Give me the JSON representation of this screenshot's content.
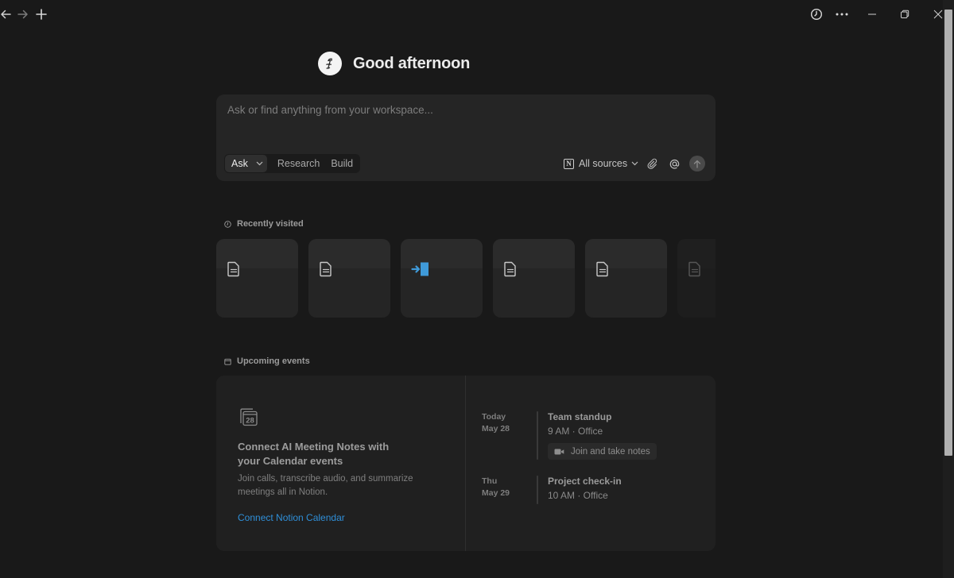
{
  "window": {
    "icons": [
      "back-arrow-icon",
      "forward-arrow-icon",
      "new-tab-plus-icon",
      "history-clock-icon",
      "more-ellipsis-icon",
      "minimize-icon",
      "restore-icon",
      "close-icon"
    ]
  },
  "greeting": {
    "text": "Good afternoon",
    "avatar_icon": "user-avatar-icon"
  },
  "ask_box": {
    "placeholder": "Ask or find anything from your workspace...",
    "modes": {
      "active": "Ask",
      "others": [
        "Research",
        "Build"
      ]
    },
    "sources_label": "All sources",
    "sources_icon": "notion-logo-icon",
    "tools": [
      "attachment-icon",
      "mention-at-icon",
      "send-arrow-icon"
    ]
  },
  "recently_visited": {
    "header": "Recently visited",
    "header_icon": "clock-icon",
    "cards": [
      {
        "icon": "page-icon"
      },
      {
        "icon": "page-icon"
      },
      {
        "icon": "sign-in-arrow-icon",
        "accent": "#3f9ad9"
      },
      {
        "icon": "page-icon"
      },
      {
        "icon": "page-icon"
      },
      {
        "icon": "page-icon",
        "faded": true
      }
    ]
  },
  "upcoming_events": {
    "header": "Upcoming events",
    "header_icon": "calendar-icon",
    "connect": {
      "icon": "calendar-28-icon",
      "calendar_day": "28",
      "title": "Connect AI Meeting Notes with your Calendar events",
      "description": "Join calls, transcribe audio, and summarize meetings all in Notion.",
      "link": "Connect Notion Calendar",
      "link_color": "#2f8fd8"
    },
    "events": [
      {
        "day": "Today",
        "date": "May 28",
        "title": "Team standup",
        "meta": "9 AM · Office",
        "join_label": "Join and take notes",
        "join_icon": "video-camera-icon"
      },
      {
        "day": "Thu",
        "date": "May 29",
        "title": "Project check-in",
        "meta": "10 AM · Office"
      }
    ]
  },
  "colors": {
    "background": "#191919",
    "surface": "#252525",
    "accent_link": "#2f8fd8"
  }
}
